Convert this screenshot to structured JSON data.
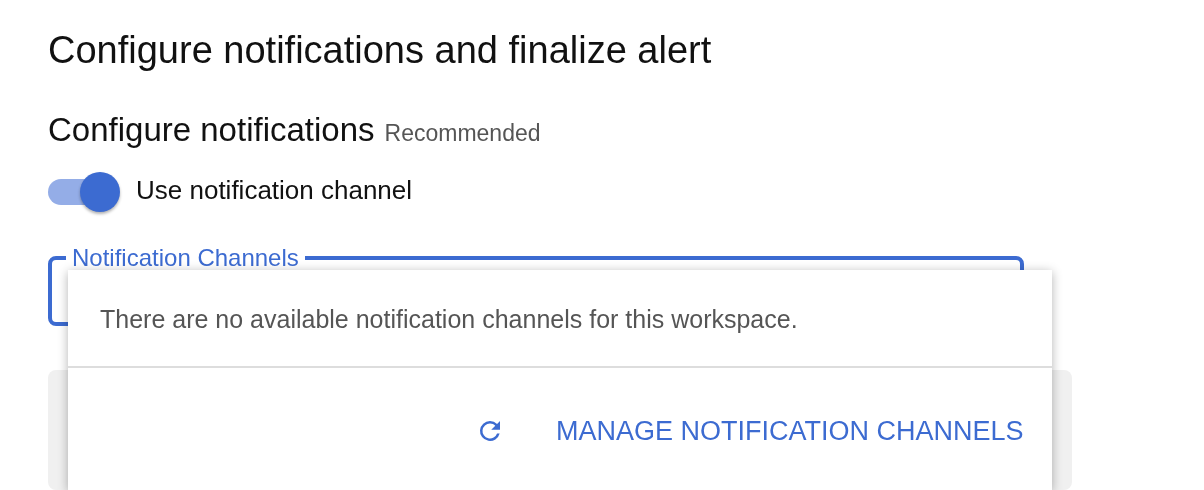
{
  "page_title": "Configure notifications and finalize alert",
  "section": {
    "heading": "Configure notifications",
    "badge": "Recommended"
  },
  "toggle": {
    "label": "Use notification channel",
    "on": true
  },
  "field": {
    "label": "Notification Channels"
  },
  "dropdown": {
    "message": "There are no available notification channels for this workspace.",
    "action": {
      "label": "MANAGE NOTIFICATION CHANNELS"
    }
  }
}
